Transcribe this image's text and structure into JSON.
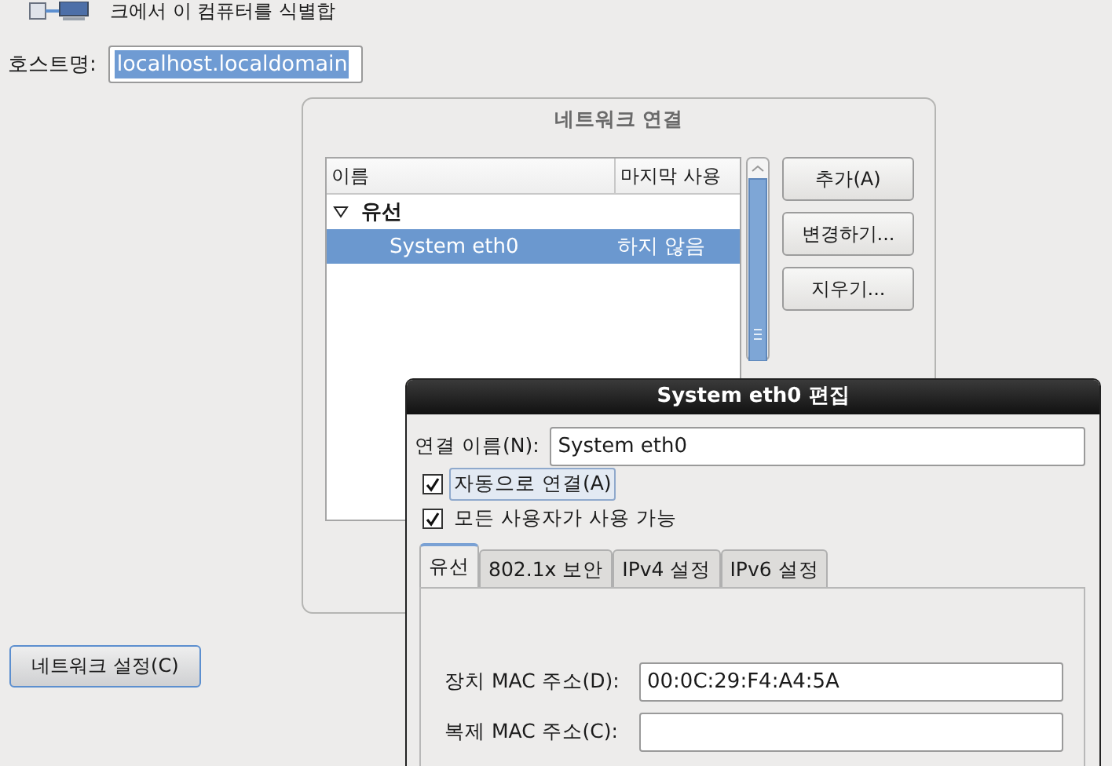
{
  "header": {
    "text": "크에서 이 컴퓨터를 식별합"
  },
  "hostname": {
    "label": "호스트명:",
    "value": "localhost.localdomain",
    "text_selected": true
  },
  "network_connections": {
    "title": "네트워크 연결",
    "columns": [
      "이름",
      "마지막 사용"
    ],
    "groups": [
      {
        "label": "유선",
        "expanded": true,
        "children": [
          {
            "name": "System eth0",
            "last_used": "하지 않음",
            "selected": true
          }
        ]
      }
    ],
    "buttons": [
      "추가(A)",
      "변경하기...",
      "지우기..."
    ]
  },
  "network_settings_button": "네트워크 설정(C)",
  "edit_dialog": {
    "title": "System eth0 편집",
    "name_label": "연결 이름(N):",
    "name_value": "System eth0",
    "checkboxes": [
      {
        "label": "자동으로 연결(A)",
        "checked": true,
        "focused": true
      },
      {
        "label": "모든 사용자가 사용 가능",
        "checked": true,
        "focused": false
      }
    ],
    "tabs": [
      {
        "label": "유선",
        "selected": true
      },
      {
        "label": "802.1x 보안",
        "selected": false
      },
      {
        "label": "IPv4 설정",
        "selected": false
      },
      {
        "label": "IPv6 설정",
        "selected": false
      }
    ],
    "fields": [
      {
        "label": "장치 MAC 주소(D):",
        "value": "00:0C:29:F4:A4:5A"
      },
      {
        "label": "복제 MAC 주소(C):"
      }
    ]
  }
}
